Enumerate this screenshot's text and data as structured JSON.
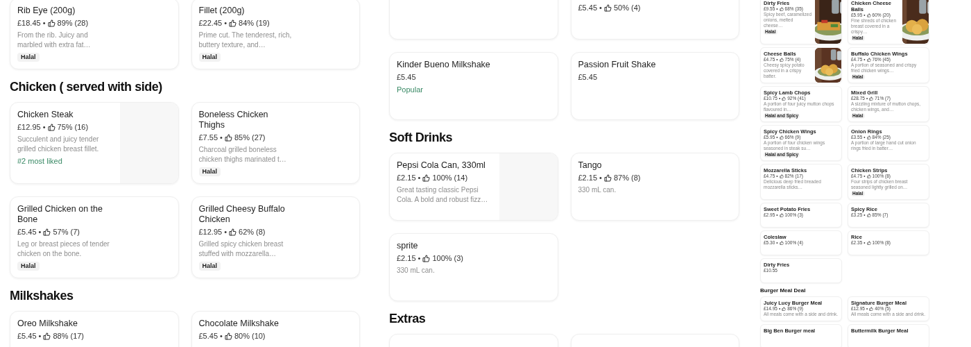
{
  "separator": "•",
  "columns": [
    {
      "sections": [
        {
          "items": [
            {
              "title": "Rib Eye (200g)",
              "price": "£18.45",
              "rating": "89% (28)",
              "description": "From the rib. Juicy and marbled with extra fat…",
              "tag": "Halal"
            },
            {
              "title": "Fillet (200g)",
              "price": "£22.45",
              "rating": "84% (19)",
              "description": "Prime cut. The tenderest, rich, buttery texture, and…",
              "tag": "Halal"
            }
          ]
        },
        {
          "heading": "Chicken ( served with side)",
          "items": [
            {
              "title": "Chicken Steak",
              "price": "£12.95",
              "rating": "75% (16)",
              "description": "Succulent and juicy tender grilled chicken breast fillet.",
              "highlight": "#2 most liked"
            },
            {
              "kind": "plain",
              "title": "Boneless Chicken Thighs",
              "price": "£7.55",
              "rating": "85% (27)",
              "description": "Charcoal grilled boneless chicken thighs marinated t…",
              "tag": "Halal"
            },
            {
              "kind": "plain",
              "title": "Grilled Chicken on the Bone",
              "price": "£5.45",
              "rating": "57% (7)",
              "description": "Leg or breast pieces of tender chicken on the bone.",
              "tag": "Halal"
            },
            {
              "kind": "plain",
              "title": "Grilled Cheesy Buffalo Chicken",
              "price": "£12.95",
              "rating": "62% (8)",
              "description": "Grilled spicy chicken breast stuffed with mozzarella…",
              "tag": "Halal"
            }
          ]
        },
        {
          "heading": "Milkshakes",
          "items": [
            {
              "title": "Oreo Milkshake",
              "price": "£5.45",
              "rating": "88% (17)"
            },
            {
              "title": "Chocolate Milkshake",
              "price": "£5.45",
              "rating": "80% (10)"
            }
          ]
        }
      ]
    },
    {
      "sections": [
        {
          "items": [
            {
              "kind": "blank"
            },
            {
              "kind": "plain",
              "price": "£5.45",
              "rating": "50% (4)"
            },
            {
              "kind": "plain",
              "title": "Kinder Bueno Milkshake",
              "price": "£5.45",
              "highlight": "Popular"
            },
            {
              "kind": "plain",
              "title": "Passion Fruit Shake",
              "price": "£5.45"
            }
          ]
        },
        {
          "heading": "Soft Drinks",
          "items": [
            {
              "title": "Pepsi Cola Can, 330ml",
              "price": "£2.15",
              "rating": "100% (14)",
              "description": "Great tasting classic Pepsi Cola. A bold and robust fizz…"
            },
            {
              "kind": "plain",
              "title": "Tango",
              "price": "£2.15",
              "rating": "87% (8)",
              "description": "330 mL can."
            },
            {
              "kind": "plain",
              "title": "sprite",
              "price": "£2.15",
              "rating": "100% (3)",
              "description": "330 mL can."
            }
          ]
        },
        {
          "heading": "Extras",
          "items": [
            {
              "kind": "blank"
            },
            {
              "kind": "blank"
            }
          ]
        }
      ]
    },
    {
      "sections": [
        {
          "items": [
            {
              "title": "Dirty Fries",
              "price": "£9.55",
              "rating": "68% (35)",
              "description": "Spicy beef, caramelized onions, melted cheese…",
              "tag": "Halal"
            },
            {
              "title": "Chicken Cheese Balls",
              "price": "£5.95",
              "rating": "60% (20)",
              "description": "Fine shreds of chicken breast covered in a crispy…",
              "tag": "Halal"
            },
            {
              "title": "Cheese Balls",
              "price": "£4.75",
              "rating": "75% (4)",
              "description": "Cheesy spicy potato covered in a crispy batter."
            },
            {
              "kind": "plain",
              "title": "Buffalo Chicken Wings",
              "price": "£4.75",
              "rating": "76% (45)",
              "description": "A portion of seasoned and crispy fried chicken wings…",
              "tag": "Halal"
            },
            {
              "kind": "plain",
              "title": "Spicy Lamb Chops",
              "price": "£10.75",
              "rating": "92% (41)",
              "description": "A portion of four juicy mutton chops flavoured in…",
              "tag": "Halal and Spicy"
            },
            {
              "kind": "plain",
              "title": "Mixed Grill",
              "price": "£28.75",
              "rating": "71% (7)",
              "description": "A sizzling mixture of mutton chops, chicken wings, and…",
              "tag": "Halal"
            },
            {
              "kind": "plain",
              "title": "Spicy Chicken Wings",
              "price": "£5.95",
              "rating": "66% (9)",
              "description": "A portion of four chicken wings seasoned in steak su…",
              "tag": "Halal and Spicy"
            },
            {
              "kind": "plain",
              "title": "Onion Rings",
              "price": "£3.55",
              "rating": "84% (25)",
              "description": "A portion of large hand cut onion rings fried in batter…"
            },
            {
              "kind": "plain",
              "title": "Mozzarella Sticks",
              "price": "£4.75",
              "rating": "82% (17)",
              "description": "Delicious deep fried breaded mozzarella sticks…"
            },
            {
              "kind": "plain",
              "title": "Chicken Strips",
              "price": "£4.75",
              "rating": "100% (8)",
              "description": "Four strips of chicken breast seasoned lightly grilled on…",
              "tag": "Halal"
            },
            {
              "kind": "plain",
              "title": "Sweet Potato Fries",
              "price": "£2.95",
              "rating": "100% (3)"
            },
            {
              "kind": "plain",
              "title": "Spicy Rice",
              "price": "£3.25",
              "rating": "85% (7)"
            },
            {
              "kind": "plain",
              "title": "Coleslaw",
              "price": "£5.30",
              "rating": "100% (4)"
            },
            {
              "kind": "plain",
              "title": "Rice",
              "price": "£2.35",
              "rating": "100% (8)"
            },
            {
              "kind": "plain",
              "title": "Dirty Fries",
              "price": "£10.55"
            }
          ]
        },
        {
          "heading": "Burger Meal Deal",
          "items": [
            {
              "title": "Juicy Lucy Burger Meal",
              "price": "£14.95",
              "rating": "86% (9)",
              "description": "All meals come with a side and drink."
            },
            {
              "title": "Signature Burger Meal",
              "price": "£12.95",
              "rating": "40% (5)",
              "description": "All meals come with a side and drink."
            },
            {
              "title": "Big Ben Burger meal"
            },
            {
              "title": "Buttermilk Burger Meal"
            }
          ]
        }
      ]
    }
  ]
}
